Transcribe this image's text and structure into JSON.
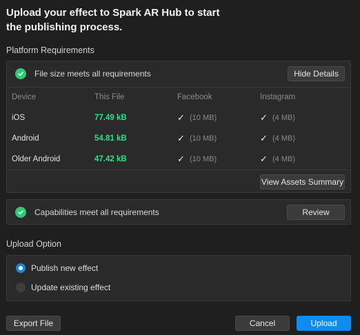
{
  "dialog": {
    "title": "Upload your effect to Spark AR Hub to start the publishing process."
  },
  "platform": {
    "section_label": "Platform Requirements",
    "status_text": "File size meets all requirements",
    "hide_details_label": "Hide Details",
    "columns": [
      "Device",
      "This File",
      "Facebook",
      "Instagram"
    ],
    "rows": [
      {
        "device": "iOS",
        "size": "77.49 kB",
        "fb_check": "✓",
        "fb_limit": "(10 MB)",
        "ig_check": "✓",
        "ig_limit": "(4 MB)"
      },
      {
        "device": "Android",
        "size": "54.81 kB",
        "fb_check": "✓",
        "fb_limit": "(10 MB)",
        "ig_check": "✓",
        "ig_limit": "(4 MB)"
      },
      {
        "device": "Older Android",
        "size": "47.42 kB",
        "fb_check": "✓",
        "fb_limit": "(10 MB)",
        "ig_check": "✓",
        "ig_limit": "(4 MB)"
      }
    ],
    "view_assets_label": "View Assets Summary"
  },
  "capabilities": {
    "status_text": "Capabilities meet all requirements",
    "review_label": "Review"
  },
  "upload_option": {
    "section_label": "Upload Option",
    "options": [
      {
        "label": "Publish new effect",
        "selected": true
      },
      {
        "label": "Update existing effect",
        "selected": false
      }
    ]
  },
  "footer": {
    "export_label": "Export File",
    "cancel_label": "Cancel",
    "upload_label": "Upload"
  },
  "colors": {
    "success_green": "#2fca74",
    "size_green": "#2fe08a",
    "accent_blue": "#0f8cf0"
  }
}
